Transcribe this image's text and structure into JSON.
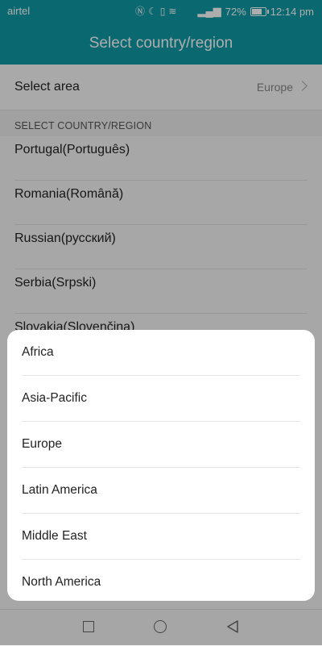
{
  "status_bar": {
    "carrier": "airtel",
    "battery": "72%",
    "time": "12:14 pm"
  },
  "app_bar": {
    "title": "Select country/region"
  },
  "area": {
    "label": "Select area",
    "value": "Europe"
  },
  "section_header": "SELECT COUNTRY/REGION",
  "countries": [
    "Portugal(Português)",
    "Romania(Română)",
    "Russian(русский)",
    "Serbia(Srpski)",
    "Slovakia(Slovenčina)"
  ],
  "area_options": [
    "Africa",
    "Asia-Pacific",
    "Europe",
    "Latin America",
    "Middle East",
    "North America"
  ],
  "colors": {
    "accent": "#109aa6"
  }
}
